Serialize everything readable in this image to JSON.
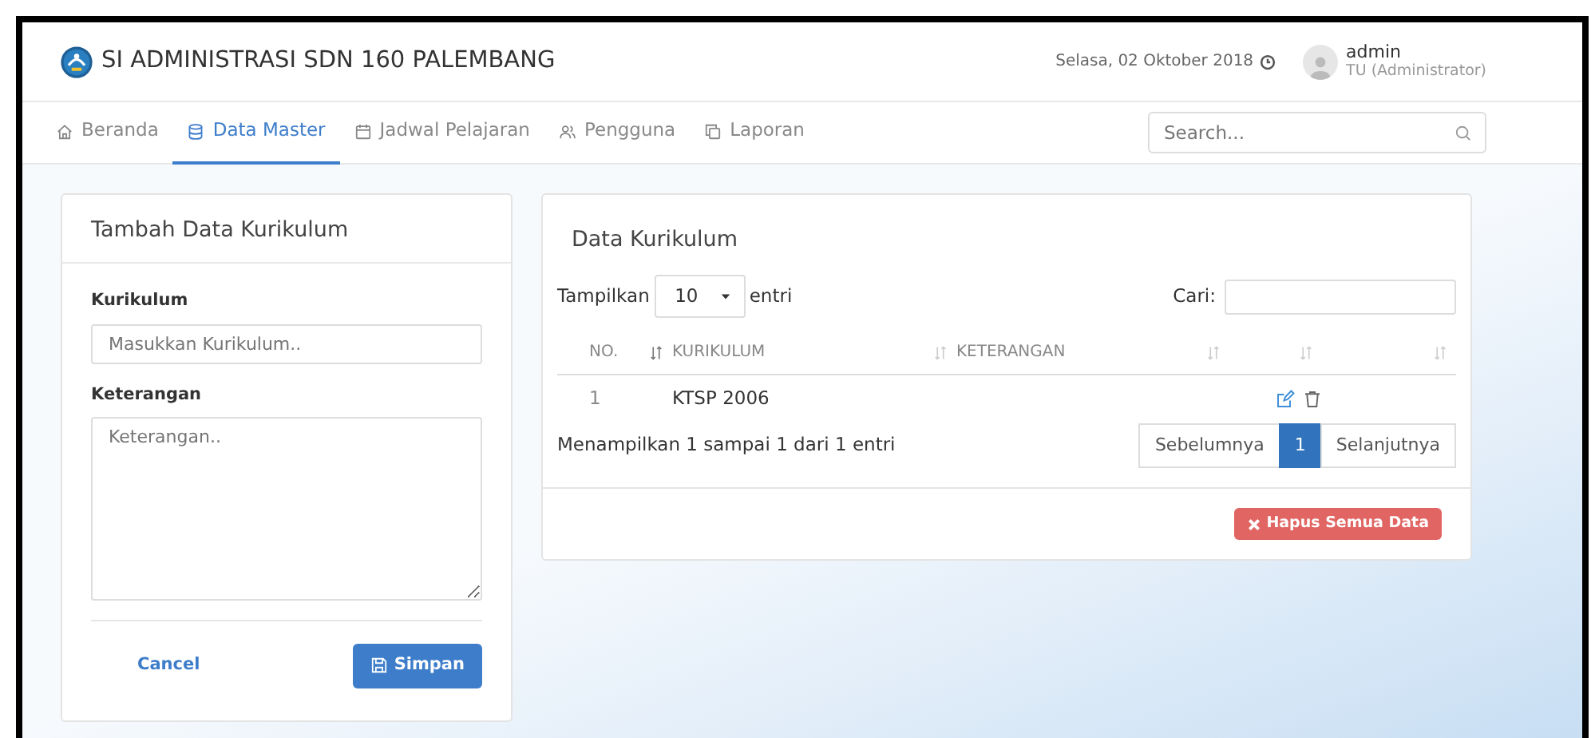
{
  "header": {
    "title": "SI ADMINISTRASI SDN 160 PALEMBANG",
    "date": "Selasa, 02 Oktober 2018",
    "user": {
      "name": "admin",
      "role": "TU (Administrator)"
    }
  },
  "nav": [
    {
      "label": "Beranda",
      "kind": "home",
      "selected": false
    },
    {
      "label": "Data Master",
      "kind": "database",
      "selected": true
    },
    {
      "label": "Jadwal Pelajaran",
      "kind": "calendar",
      "selected": false
    },
    {
      "label": "Pengguna",
      "kind": "users",
      "selected": false
    },
    {
      "label": "Laporan",
      "kind": "copy",
      "selected": false
    }
  ],
  "search": {
    "placeholder": "Search..."
  },
  "form": {
    "title": "Tambah Data Kurikulum",
    "fields": [
      {
        "label": "Kurikulum",
        "kind": "input",
        "placeholder": "Masukkan Kurikulum.."
      },
      {
        "label": "Keterangan",
        "kind": "textarea",
        "placeholder": "Keterangan.."
      }
    ],
    "cancel": "Cancel",
    "save": "Simpan"
  },
  "table": {
    "title": "Data Kurikulum",
    "show_label": "Tampilkan",
    "page_size": "10",
    "entries_label": "entri",
    "search_label": "Cari:",
    "columns": [
      "NO.",
      "KURIKULUM",
      "KETERANGAN"
    ],
    "rows": [
      {
        "no": "1",
        "kurikulum": "KTSP 2006"
      }
    ],
    "info": "Menampilkan 1 sampai 1 dari 1 entri",
    "pages": [
      {
        "label": "Sebelumnya",
        "selected": false
      },
      {
        "label": "1",
        "selected": true
      },
      {
        "label": "Selanjutnya",
        "selected": false
      }
    ],
    "delete_all": "Hapus Semua Data"
  }
}
